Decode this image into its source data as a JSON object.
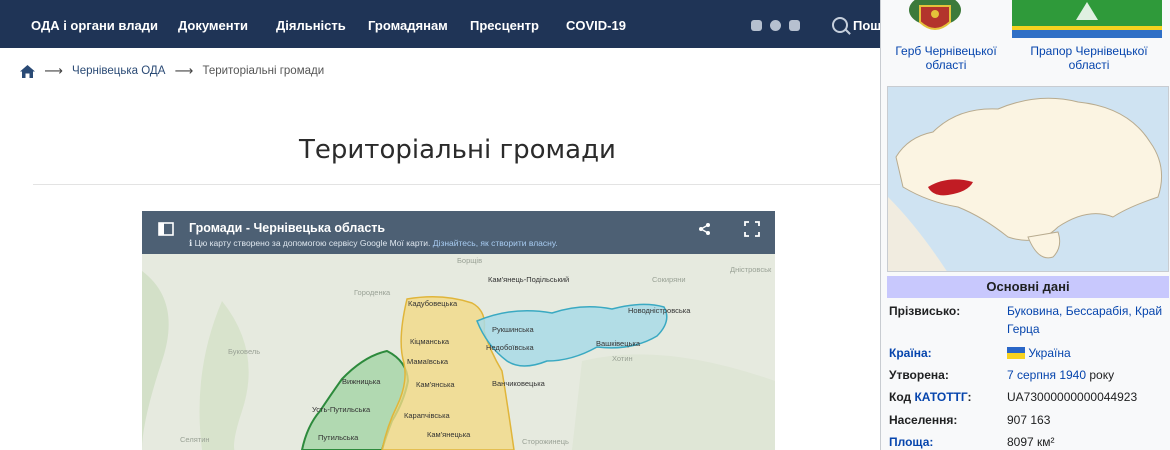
{
  "nav": {
    "items": [
      "ОДА і органи влади",
      "Документи",
      "Діяльність",
      "Громадянам",
      "Пресцентр",
      "COVID-19"
    ],
    "search_label": "Пош"
  },
  "breadcrumb": {
    "parent": "Чернівецька ОДА",
    "current": "Територіальні громади"
  },
  "page": {
    "title": "Територіальні громади"
  },
  "map": {
    "title": "Громади - Чернівецька область",
    "info_text": "Цю карту створено за допомогою сервісу Google Мої карти.",
    "info_link": "Дізнайтесь, як створити власну.",
    "places": [
      "Кадубовецька",
      "Кам'янець-Подільський",
      "Новодністровська",
      "Рукшинська",
      "Недобоївська",
      "Вашківецька",
      "Кіцманська",
      "Мамаївська",
      "Кам'янська",
      "Ванчиковецька",
      "Вижницька",
      "Усть-Путильська",
      "Карапчівська",
      "Кам'янецька",
      "Путильська"
    ],
    "faint_places": [
      "Борщів",
      "Городенка",
      "Буковель",
      "Сторожинець",
      "Селятин",
      "Хотин",
      "Сокиряни",
      "Дністровськ"
    ]
  },
  "infobox": {
    "coat_caption_1": "Герб Чернівецької",
    "coat_caption_2": "області",
    "flag_caption": "Прапор Чернівецької області",
    "section_title": "Основні дані",
    "rows": [
      {
        "label": "Прізвисько:",
        "value": "Буковина, Бессарабія, Край",
        "value2": "Герца"
      },
      {
        "label": "Країна:",
        "value": "Україна"
      },
      {
        "label": "Утворена:",
        "value": "7 серпня 1940",
        "suffix": " року"
      },
      {
        "label": "Код",
        "label_link": "КАТОТТГ",
        "label_suffix": ":",
        "value": "UA73000000000044923"
      },
      {
        "label": "Населення:",
        "value": "907 163"
      },
      {
        "label": "Площа:",
        "value": "8097 км²"
      }
    ]
  }
}
